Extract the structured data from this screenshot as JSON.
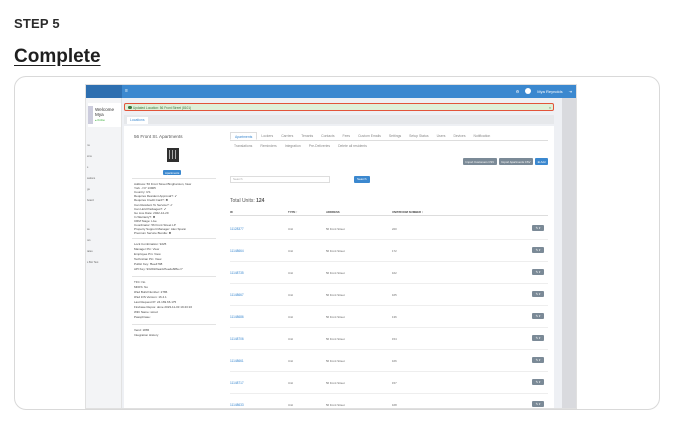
{
  "step_label": "STEP 5",
  "heading": "Complete",
  "app": {
    "topbar": {
      "menu_icon": "≡",
      "user_name": "Mya Reynolds"
    },
    "sidebar": {
      "welcome": "Welcome",
      "user": "Mya",
      "status": "● Online",
      "items": [
        "ns",
        "ions",
        "s",
        "sations",
        "gs",
        "board",
        "ce",
        "ors",
        "tates",
        "s Bot Test"
      ]
    },
    "alert": {
      "text": "Updated Location: 56 Front Street (8101)",
      "close": "×"
    },
    "breadcrumb": "Locations",
    "location": {
      "title": "56 Front St. Apartments",
      "badge": "Apartments",
      "details_a": [
        "Address: 56 Front Street Binghamton, New",
        "York - NY 13905",
        "Country: US",
        "Requires Resident Approval?: ✔",
        "Requires Credit Card?: ✖",
        "Can Resident To Service?: ✔",
        "Can Hold Packages?: ✔",
        "Go Live Date: 2022-12-29",
        "In Warranty?: ✖",
        "CRM Stage: Live",
        "Coordinator: 56 Front Street LP",
        "Property Support Manager: Alex Spann",
        "Premium Service Bundle: ✖"
      ],
      "details_b": [
        "Lock Combination: 9225",
        "Manager Pin: View",
        "Employee Pin: View",
        "Technician Pin: View",
        "Public Key: f5ee4798",
        "API Key: 93c63c9ea4d7eede6f8a c7"
      ],
      "details_c": [
        "TFC: No",
        "MDFS: No",
        "iPad Build Number: 2786",
        "iPad iOS Version: 16.4.1",
        "Last Request IP: 24.169.66.175",
        "Firebase Repos: done 2023-11-03 19:43:16",
        "WiFi Name: wired",
        "Passphrase:"
      ],
      "details_d": [
        "Vend: 1865",
        "Integration History"
      ]
    },
    "tabs_row1": [
      "Apartments",
      "Lockers",
      "Carriers",
      "Tenants",
      "Contacts",
      "Fees",
      "Custom Emails",
      "Settings",
      "Setup Status",
      "Users",
      "Devices",
      "Notification"
    ],
    "tabs_row2": [
      "Translations",
      "Reminders",
      "Integration",
      "Pre-Deliveries",
      "Delete all residents"
    ],
    "buttons": [
      "Import Customers CSV",
      "Import Apartments CSV",
      "⊕ Add"
    ],
    "search": {
      "placeholder": "Search",
      "button": "Search"
    },
    "total": {
      "label": "Total Units:",
      "count": "124"
    },
    "columns": [
      "ID",
      "TYPE ↑",
      "ADDRESS",
      "UNIT/ROOM NUMBER ↕"
    ],
    "rows": [
      {
        "id": "11128377",
        "type": "Unit",
        "address": "56 Front Street",
        "unit": "220"
      },
      {
        "id": "11148664",
        "type": "Unit",
        "address": "56 Front Street",
        "unit": "172"
      },
      {
        "id": "11148735",
        "type": "Unit",
        "address": "56 Front Street",
        "unit": "162"
      },
      {
        "id": "11148667",
        "type": "Unit",
        "address": "56 Front Street",
        "unit": "165"
      },
      {
        "id": "11148686",
        "type": "Unit",
        "address": "56 Front Street",
        "unit": "136"
      },
      {
        "id": "11148706",
        "type": "Unit",
        "address": "56 Front Street",
        "unit": "154"
      },
      {
        "id": "11148661",
        "type": "Unit",
        "address": "56 Front Street",
        "unit": "166"
      },
      {
        "id": "11148717",
        "type": "Unit",
        "address": "56 Front Street",
        "unit": "157"
      },
      {
        "id": "11148633",
        "type": "Unit",
        "address": "56 Front Street",
        "unit": "168"
      }
    ],
    "row_action": "✎ ▾"
  },
  "colors": {
    "accent": "#3b88cf",
    "alert_border": "#e2543a",
    "alert_bg": "#dff0d8"
  }
}
